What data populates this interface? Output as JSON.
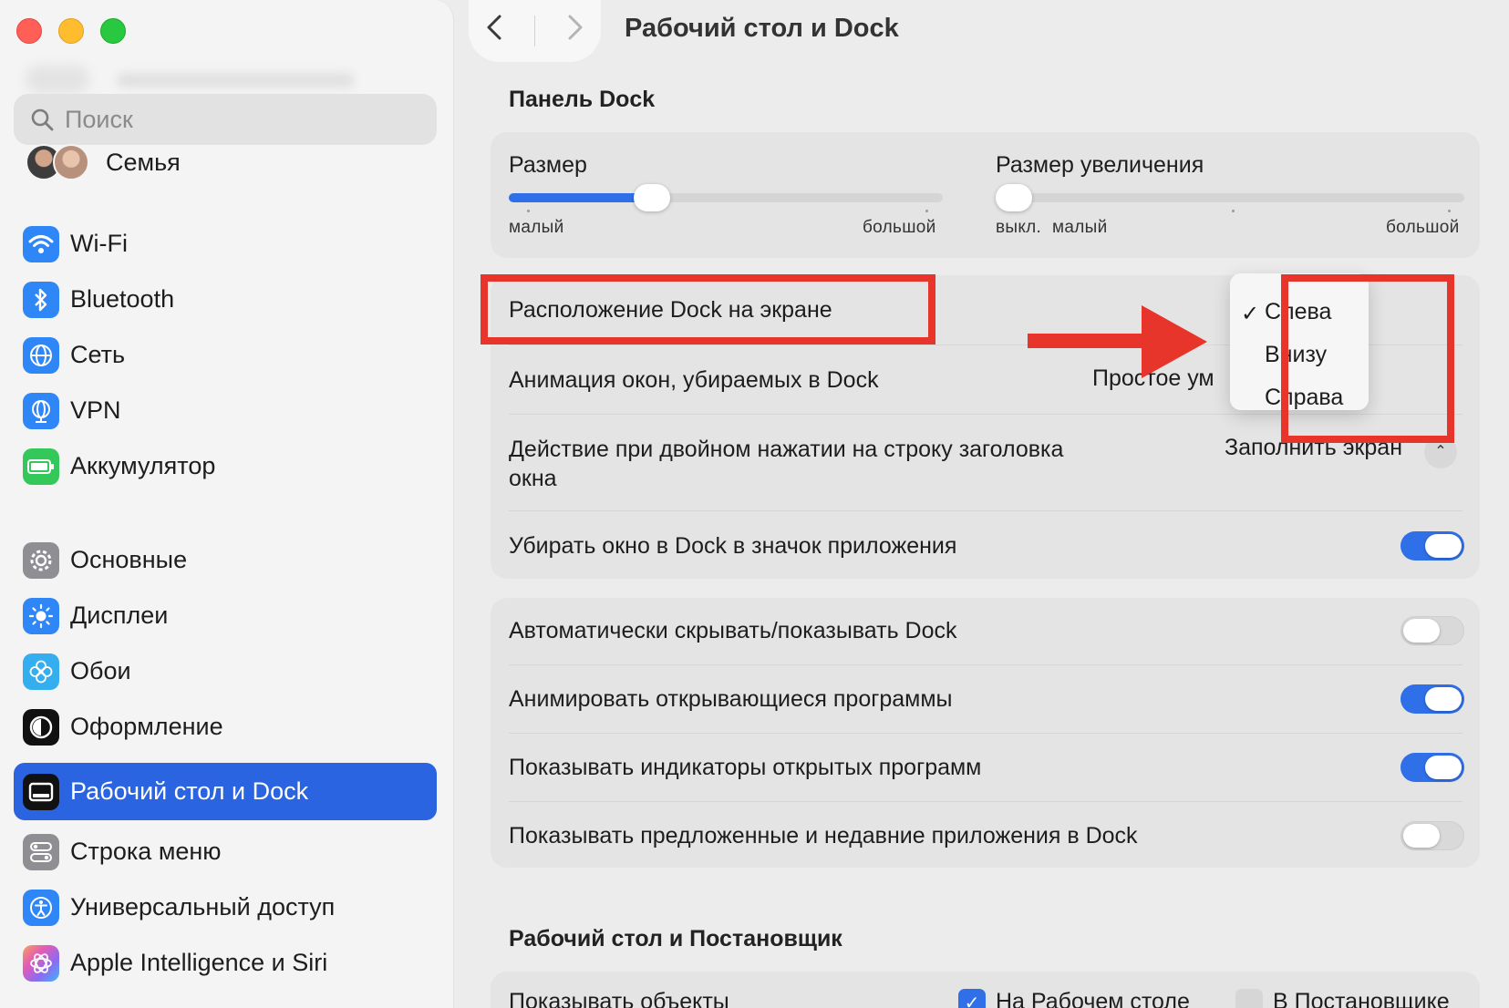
{
  "window": {
    "title": "Рабочий стол и Dock"
  },
  "sidebar": {
    "search_placeholder": "Поиск",
    "family_label": "Семья",
    "items": [
      {
        "label": "Wi-Fi",
        "icon": "wifi-icon",
        "color": "#2f86f6"
      },
      {
        "label": "Bluetooth",
        "icon": "bluetooth-icon",
        "color": "#2f86f6"
      },
      {
        "label": "Сеть",
        "icon": "globe-icon",
        "color": "#2f86f6"
      },
      {
        "label": "VPN",
        "icon": "vpn-globe-icon",
        "color": "#2f86f6"
      },
      {
        "label": "Аккумулятор",
        "icon": "battery-icon",
        "color": "#34c759"
      },
      {
        "label": "Основные",
        "icon": "gear-icon",
        "color": "#8e8e93"
      },
      {
        "label": "Дисплеи",
        "icon": "sun-icon",
        "color": "#2f86f6"
      },
      {
        "label": "Обои",
        "icon": "flower-icon",
        "color": "#35aef0"
      },
      {
        "label": "Оформление",
        "icon": "appearance-icon",
        "color": "#111111"
      },
      {
        "label": "Рабочий стол и Dock",
        "icon": "dock-icon",
        "color": "#111111",
        "active": true
      },
      {
        "label": "Строка меню",
        "icon": "menubar-icon",
        "color": "#8e8e93"
      },
      {
        "label": "Универсальный доступ",
        "icon": "accessibility-icon",
        "color": "#2f86f6"
      },
      {
        "label": "Apple Intelligence и Siri",
        "icon": "siri-icon",
        "color": "#c66ee0"
      }
    ]
  },
  "main": {
    "title": "Рабочий стол и Dock",
    "dock_section_title": "Панель Dock",
    "size": {
      "label": "Размер",
      "min_label": "малый",
      "max_label": "большой",
      "value": 0.33
    },
    "magnification": {
      "label": "Размер увеличения",
      "off_label": "выкл.",
      "min_label": "малый",
      "max_label": "большой",
      "value": 0.0
    },
    "position": {
      "label": "Расположение Dock на экране",
      "menu_options": [
        "Слева",
        "Внизу",
        "Справа"
      ],
      "selected": "Слева"
    },
    "minimize_effect": {
      "label": "Анимация окон, убираемых в Dock",
      "value": "Простое ум"
    },
    "double_click": {
      "label_line1": "Действие при двойном нажатии на строку заголовка",
      "label_line2": "окна",
      "value": "Заполнить экран"
    },
    "minimize_into_app": {
      "label": "Убирать окно в Dock в значок приложения",
      "on": true
    },
    "autohide": {
      "label": "Автоматически скрывать/показывать Dock",
      "on": false
    },
    "animate": {
      "label": "Анимировать открывающиеся программы",
      "on": true
    },
    "indicators": {
      "label": "Показывать индикаторы открытых программ",
      "on": true
    },
    "recent_apps": {
      "label": "Показывать предложенные и недавние приложения в Dock",
      "on": false
    },
    "desktop_section_title": "Рабочий стол и Постановщик",
    "show_items": {
      "label": "Показывать объекты",
      "on_desktop": "На Рабочем столе",
      "in_stage_manager": "В Постановщике"
    }
  },
  "colors": {
    "accent": "#2f6fe8",
    "annotation": "#e8352b",
    "sidebar_active": "#2a64e0"
  }
}
